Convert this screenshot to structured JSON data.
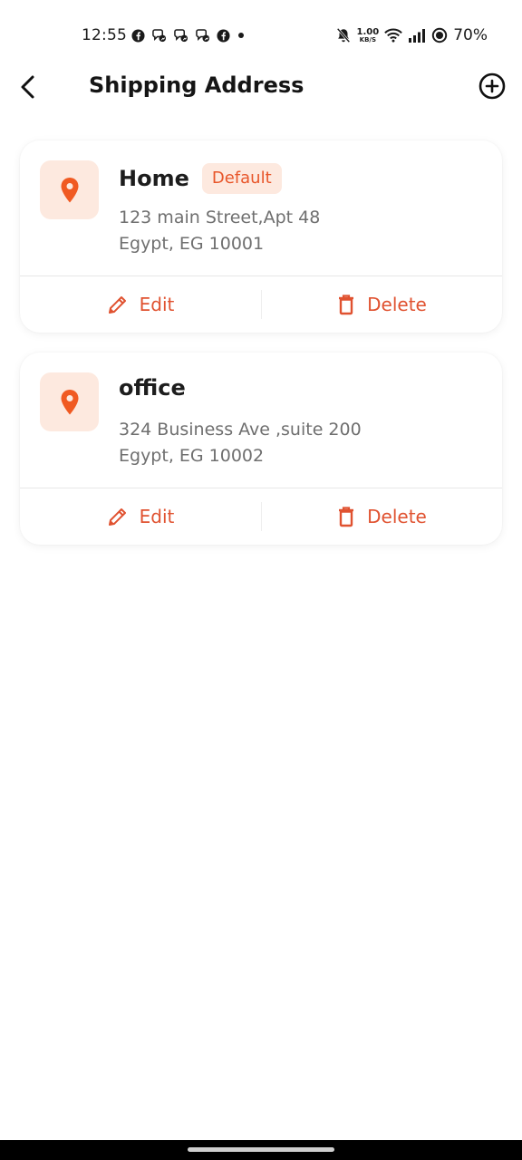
{
  "status_bar": {
    "time": "12:55",
    "speed_value": "1.00",
    "speed_unit": "KB/S",
    "battery": "70%"
  },
  "header": {
    "title": "Shipping Address"
  },
  "addresses": [
    {
      "title": "Home",
      "badge": "Default",
      "line1": "123 main Street,Apt 48",
      "line2": "Egypt, EG  10001",
      "edit_label": "Edit",
      "delete_label": "Delete"
    },
    {
      "title": "office",
      "line1": "324 Business Ave ,suite 200",
      "line2": "Egypt, EG  10002",
      "edit_label": "Edit",
      "delete_label": "Delete"
    }
  ],
  "colors": {
    "accent": "#e8562a",
    "pin": "#f05a22",
    "pin_bg": "#fde9df"
  }
}
